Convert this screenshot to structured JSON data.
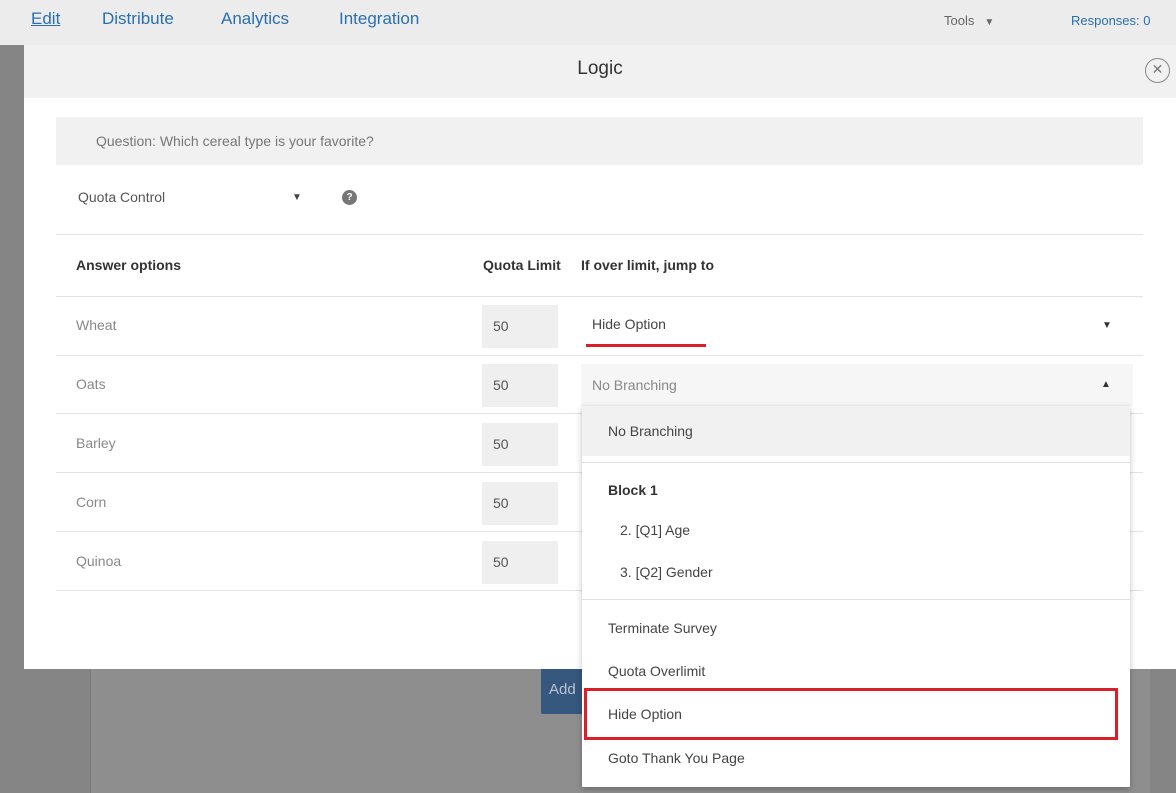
{
  "nav": {
    "tabs": [
      "Edit",
      "Distribute",
      "Analytics",
      "Integration"
    ],
    "tools_label": "Tools",
    "responses_label": "Responses: 0"
  },
  "modal": {
    "title": "Logic",
    "question": "Question: Which cereal type is your favorite?",
    "logic_type": "Quota Control",
    "columns": {
      "answers": "Answer options",
      "quota": "Quota Limit",
      "jump": "If over limit, jump to"
    },
    "rows": [
      {
        "option": "Wheat",
        "quota": "50",
        "jump": "Hide Option"
      },
      {
        "option": "Oats",
        "quota": "50",
        "jump": "No Branching"
      },
      {
        "option": "Barley",
        "quota": "50"
      },
      {
        "option": "Corn",
        "quota": "50"
      },
      {
        "option": "Quinoa",
        "quota": "50"
      }
    ]
  },
  "dropdown": {
    "no_branching": "No Branching",
    "block_header": "Block 1",
    "questions": [
      "2. [Q1] Age",
      "3. [Q2] Gender"
    ],
    "terminate": "Terminate Survey",
    "overlimit": "Quota Overlimit",
    "hide_option": "Hide Option",
    "thank_you": "Goto Thank You Page"
  },
  "background": {
    "add_button_label": "Add"
  },
  "colors": {
    "accent_blue": "#2a6fb3",
    "highlight_red": "#d9202a",
    "header_gray": "#f1f1f1"
  }
}
